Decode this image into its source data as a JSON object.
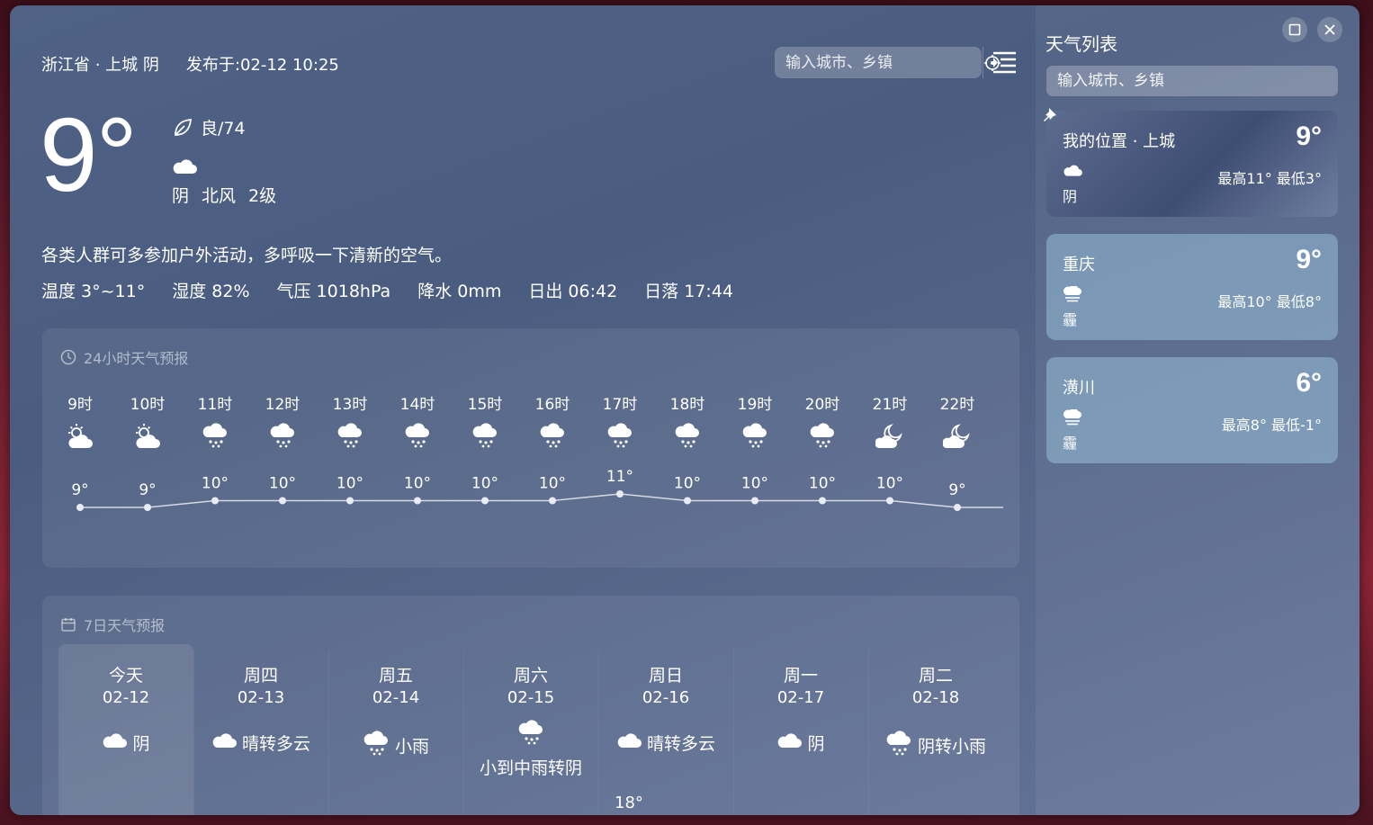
{
  "header": {
    "location": "浙江省 · 上城 阴",
    "published": "发布于:02-12 10:25",
    "search_placeholder": "输入城市、乡镇"
  },
  "current": {
    "temp": "9°",
    "aqi": "良/74",
    "weather": "阴",
    "wind_dir": "北风",
    "wind_level": "2级",
    "advice": "各类人群可多参加户外活动，多呼吸一下清新的空气。",
    "temperature_range": "温度 3°~11°",
    "humidity": "湿度 82%",
    "pressure": "气压 1018hPa",
    "precip": "降水 0mm",
    "sunrise": "日出 06:42",
    "sunset": "日落 17:44"
  },
  "hourly": {
    "title": "24小时天气预报",
    "hours": [
      {
        "time": "9时",
        "temp": "9°",
        "icon": "sun-cloud-icon",
        "value": 9
      },
      {
        "time": "10时",
        "temp": "9°",
        "icon": "sun-cloud-icon",
        "value": 9
      },
      {
        "time": "11时",
        "temp": "10°",
        "icon": "rain-icon",
        "value": 10
      },
      {
        "time": "12时",
        "temp": "10°",
        "icon": "rain-icon",
        "value": 10
      },
      {
        "time": "13时",
        "temp": "10°",
        "icon": "rain-icon",
        "value": 10
      },
      {
        "time": "14时",
        "temp": "10°",
        "icon": "rain-icon",
        "value": 10
      },
      {
        "time": "15时",
        "temp": "10°",
        "icon": "rain-icon",
        "value": 10
      },
      {
        "time": "16时",
        "temp": "10°",
        "icon": "rain-icon",
        "value": 10
      },
      {
        "time": "17时",
        "temp": "11°",
        "icon": "rain-icon",
        "value": 11
      },
      {
        "time": "18时",
        "temp": "10°",
        "icon": "rain-icon",
        "value": 10
      },
      {
        "time": "19时",
        "temp": "10°",
        "icon": "rain-icon",
        "value": 10
      },
      {
        "time": "20时",
        "temp": "10°",
        "icon": "rain-icon",
        "value": 10
      },
      {
        "time": "21时",
        "temp": "10°",
        "icon": "moon-cloud-icon",
        "value": 10
      },
      {
        "time": "22时",
        "temp": "9°",
        "icon": "moon-cloud-icon",
        "value": 9
      }
    ]
  },
  "daily": {
    "title": "7日天气预报",
    "days": [
      {
        "name": "今天",
        "date": "02-12",
        "weather": "阴",
        "icon": "cloud-icon"
      },
      {
        "name": "周四",
        "date": "02-13",
        "weather": "晴转多云",
        "icon": "cloud-icon"
      },
      {
        "name": "周五",
        "date": "02-14",
        "weather": "小雨",
        "icon": "rain-icon"
      },
      {
        "name": "周六",
        "date": "02-15",
        "weather": "小到中雨转阴",
        "icon": "rain-icon"
      },
      {
        "name": "周日",
        "date": "02-16",
        "weather": "晴转多云",
        "icon": "cloud-icon"
      },
      {
        "name": "周一",
        "date": "02-17",
        "weather": "阴",
        "icon": "cloud-icon"
      },
      {
        "name": "周二",
        "date": "02-18",
        "weather": "阴转小雨",
        "icon": "rain-icon"
      }
    ],
    "partial_high": "18°"
  },
  "sidebar": {
    "title": "天气列表",
    "search_placeholder": "输入城市、乡镇",
    "cities": [
      {
        "name": "我的位置 · 上城",
        "temp": "9°",
        "weather": "阴",
        "range": "最高11° 最低3°"
      },
      {
        "name": "重庆",
        "temp": "9°",
        "weather": "霾",
        "range": "最高10° 最低8°"
      },
      {
        "name": "潢川",
        "temp": "6°",
        "weather": "霾",
        "range": "最高8° 最低-1°"
      }
    ]
  }
}
